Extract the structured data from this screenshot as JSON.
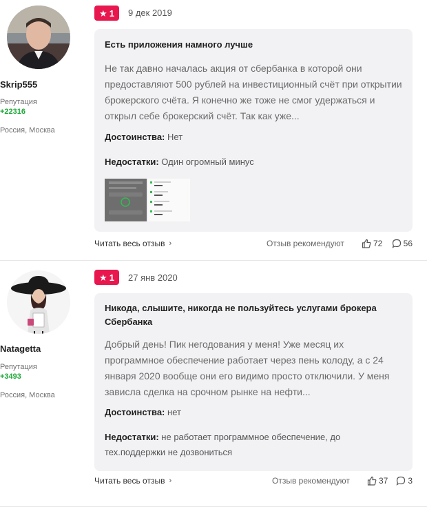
{
  "reviews": [
    {
      "author": {
        "username": "Skrip555",
        "reputation_label": "Репутация",
        "reputation_value": "+22316",
        "location": "Россия, Москва"
      },
      "rating": "1",
      "date": "9 дек 2019",
      "title": "Есть приложения намного лучше",
      "body": "Не так давно началась акция от сбербанка в которой они предоставляют 500 рублей на инвестиционный счёт при открытии брокерского счёта. Я конечно же тоже не смог удержаться и открыл себе брокерский счёт. Так как уже...",
      "pros_label": "Достоинства:",
      "pros": "Нет",
      "cons_label": "Недостатки:",
      "cons": "Один огромный минус",
      "read_more": "Читать весь отзыв",
      "recommend_label": "Отзыв рекомендуют",
      "likes": "72",
      "comments": "56"
    },
    {
      "author": {
        "username": "Natagetta",
        "reputation_label": "Репутация",
        "reputation_value": "+3493",
        "location": "Россия, Москва"
      },
      "rating": "1",
      "date": "27 янв 2020",
      "title": "Никода, слышите, никогда не пользуйтесь услугами брокера Сбербанка",
      "body": "Добрый день! Пик негодования у меня! Уже месяц их программное обеспечение работает через пень колоду, а с 24 января 2020 вообще они его видимо просто отключили. У меня зависла сделка на срочном рынке на нефти...",
      "pros_label": "Достоинства:",
      "pros": "нет",
      "cons_label": "Недостатки:",
      "cons": "не работает программное обеспечение, до тех.поддержки не дозвониться",
      "read_more": "Читать весь отзыв",
      "recommend_label": "Отзыв рекомендуют",
      "likes": "37",
      "comments": "3"
    }
  ],
  "colors": {
    "badge": "#e8174e",
    "reputation": "#1faa3a",
    "card_bg": "#f2f2f4"
  },
  "icons": {
    "rating": "star-icon",
    "likes": "thumbs-up-icon",
    "comments": "comment-icon",
    "read_more": "chevron-right-icon"
  }
}
